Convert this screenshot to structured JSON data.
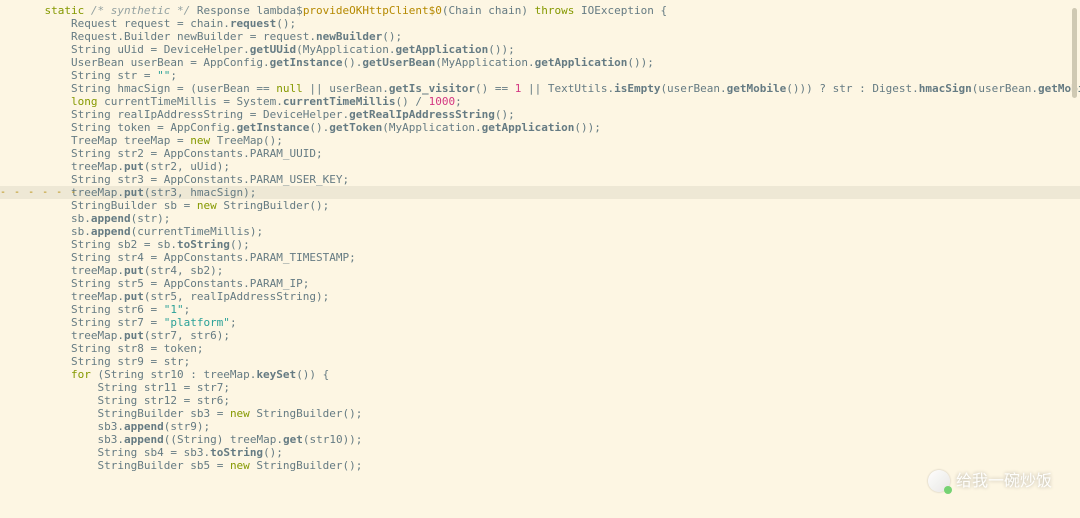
{
  "language": "java",
  "watermark": {
    "prefix": "",
    "text": "给我一碗炒饭",
    "icon_name": "wechat-icon"
  },
  "highlight_line_index": 14,
  "lines": [
    {
      "indent": 1,
      "tokens": [
        {
          "t": "kw",
          "v": "static"
        },
        {
          "t": "sp"
        },
        {
          "t": "cm",
          "v": "/* synthetic */"
        },
        {
          "t": "sp"
        },
        {
          "t": "id",
          "v": "Response lambda$"
        },
        {
          "t": "fnacc",
          "v": "provideOKHttpClient$0"
        },
        {
          "t": "id",
          "v": "(Chain chain) "
        },
        {
          "t": "kw",
          "v": "throws"
        },
        {
          "t": "sp"
        },
        {
          "t": "id",
          "v": "IOException {"
        }
      ]
    },
    {
      "indent": 2,
      "tokens": [
        {
          "t": "id",
          "v": "Request request = chain."
        },
        {
          "t": "bold",
          "v": "request"
        },
        {
          "t": "id",
          "v": "();"
        }
      ]
    },
    {
      "indent": 2,
      "tokens": [
        {
          "t": "id",
          "v": "Request.Builder newBuilder = request."
        },
        {
          "t": "bold",
          "v": "newBuilder"
        },
        {
          "t": "id",
          "v": "();"
        }
      ]
    },
    {
      "indent": 2,
      "tokens": [
        {
          "t": "id",
          "v": "String uUid = DeviceHelper."
        },
        {
          "t": "bold",
          "v": "getUUid"
        },
        {
          "t": "id",
          "v": "(MyApplication."
        },
        {
          "t": "bold",
          "v": "getApplication"
        },
        {
          "t": "id",
          "v": "());"
        }
      ]
    },
    {
      "indent": 2,
      "tokens": [
        {
          "t": "id",
          "v": "UserBean userBean = AppConfig."
        },
        {
          "t": "bold",
          "v": "getInstance"
        },
        {
          "t": "id",
          "v": "()."
        },
        {
          "t": "bold",
          "v": "getUserBean"
        },
        {
          "t": "id",
          "v": "(MyApplication."
        },
        {
          "t": "bold",
          "v": "getApplication"
        },
        {
          "t": "id",
          "v": "());"
        }
      ]
    },
    {
      "indent": 2,
      "tokens": [
        {
          "t": "id",
          "v": "String str = "
        },
        {
          "t": "str",
          "v": "\"\""
        },
        {
          "t": "id",
          "v": ";"
        }
      ]
    },
    {
      "indent": 2,
      "tokens": [
        {
          "t": "id",
          "v": "String hmacSign = (userBean == "
        },
        {
          "t": "kw",
          "v": "null"
        },
        {
          "t": "id",
          "v": " || userBean."
        },
        {
          "t": "bold",
          "v": "getIs_visitor"
        },
        {
          "t": "id",
          "v": "() == "
        },
        {
          "t": "num",
          "v": "1"
        },
        {
          "t": "id",
          "v": " || TextUtils."
        },
        {
          "t": "bold",
          "v": "isEmpty"
        },
        {
          "t": "id",
          "v": "(userBean."
        },
        {
          "t": "bold",
          "v": "getMobile"
        },
        {
          "t": "id",
          "v": "())) ? str : Digest."
        },
        {
          "t": "bold",
          "v": "hmacSign"
        },
        {
          "t": "id",
          "v": "(userBean."
        },
        {
          "t": "bold",
          "v": "getMobile"
        },
        {
          "t": "id",
          "v": "());"
        }
      ]
    },
    {
      "indent": 2,
      "tokens": [
        {
          "t": "kw",
          "v": "long"
        },
        {
          "t": "id",
          "v": " currentTimeMillis = System."
        },
        {
          "t": "bold",
          "v": "currentTimeMillis"
        },
        {
          "t": "id",
          "v": "() / "
        },
        {
          "t": "num",
          "v": "1000"
        },
        {
          "t": "id",
          "v": ";"
        }
      ]
    },
    {
      "indent": 2,
      "tokens": [
        {
          "t": "id",
          "v": "String realIpAddressString = DeviceHelper."
        },
        {
          "t": "bold",
          "v": "getRealIpAddressString"
        },
        {
          "t": "id",
          "v": "();"
        }
      ]
    },
    {
      "indent": 2,
      "tokens": [
        {
          "t": "id",
          "v": "String token = AppConfig."
        },
        {
          "t": "bold",
          "v": "getInstance"
        },
        {
          "t": "id",
          "v": "()."
        },
        {
          "t": "bold",
          "v": "getToken"
        },
        {
          "t": "id",
          "v": "(MyApplication."
        },
        {
          "t": "bold",
          "v": "getApplication"
        },
        {
          "t": "id",
          "v": "());"
        }
      ]
    },
    {
      "indent": 2,
      "tokens": [
        {
          "t": "id",
          "v": "TreeMap treeMap = "
        },
        {
          "t": "kw",
          "v": "new"
        },
        {
          "t": "id",
          "v": " TreeMap();"
        }
      ]
    },
    {
      "indent": 2,
      "tokens": [
        {
          "t": "id",
          "v": "String str2 = AppConstants.PARAM_UUID;"
        }
      ]
    },
    {
      "indent": 2,
      "tokens": [
        {
          "t": "id",
          "v": "treeMap."
        },
        {
          "t": "bold",
          "v": "put"
        },
        {
          "t": "id",
          "v": "(str2, uUid);"
        }
      ]
    },
    {
      "indent": 2,
      "tokens": [
        {
          "t": "id",
          "v": "String str3 = AppConstants.PARAM_USER_KEY;"
        }
      ]
    },
    {
      "indent": 2,
      "hl": true,
      "tokens": [
        {
          "t": "id",
          "v": "treeMap."
        },
        {
          "t": "bold",
          "v": "put"
        },
        {
          "t": "id",
          "v": "(str3, hmacSign);"
        }
      ]
    },
    {
      "indent": 2,
      "tokens": [
        {
          "t": "id",
          "v": "StringBuilder sb = "
        },
        {
          "t": "kw",
          "v": "new"
        },
        {
          "t": "id",
          "v": " StringBuilder();"
        }
      ]
    },
    {
      "indent": 2,
      "tokens": [
        {
          "t": "id",
          "v": "sb."
        },
        {
          "t": "bold",
          "v": "append"
        },
        {
          "t": "id",
          "v": "(str);"
        }
      ]
    },
    {
      "indent": 2,
      "tokens": [
        {
          "t": "id",
          "v": "sb."
        },
        {
          "t": "bold",
          "v": "append"
        },
        {
          "t": "id",
          "v": "(currentTimeMillis);"
        }
      ]
    },
    {
      "indent": 2,
      "tokens": [
        {
          "t": "id",
          "v": "String sb2 = sb."
        },
        {
          "t": "bold",
          "v": "toString"
        },
        {
          "t": "id",
          "v": "();"
        }
      ]
    },
    {
      "indent": 2,
      "tokens": [
        {
          "t": "id",
          "v": "String str4 = AppConstants.PARAM_TIMESTAMP;"
        }
      ]
    },
    {
      "indent": 2,
      "tokens": [
        {
          "t": "id",
          "v": "treeMap."
        },
        {
          "t": "bold",
          "v": "put"
        },
        {
          "t": "id",
          "v": "(str4, sb2);"
        }
      ]
    },
    {
      "indent": 2,
      "tokens": [
        {
          "t": "id",
          "v": "String str5 = AppConstants.PARAM_IP;"
        }
      ]
    },
    {
      "indent": 2,
      "tokens": [
        {
          "t": "id",
          "v": "treeMap."
        },
        {
          "t": "bold",
          "v": "put"
        },
        {
          "t": "id",
          "v": "(str5, realIpAddressString);"
        }
      ]
    },
    {
      "indent": 2,
      "tokens": [
        {
          "t": "id",
          "v": "String str6 = "
        },
        {
          "t": "str",
          "v": "\"1\""
        },
        {
          "t": "id",
          "v": ";"
        }
      ]
    },
    {
      "indent": 2,
      "tokens": [
        {
          "t": "id",
          "v": "String str7 = "
        },
        {
          "t": "str",
          "v": "\"platform\""
        },
        {
          "t": "id",
          "v": ";"
        }
      ]
    },
    {
      "indent": 2,
      "tokens": [
        {
          "t": "id",
          "v": "treeMap."
        },
        {
          "t": "bold",
          "v": "put"
        },
        {
          "t": "id",
          "v": "(str7, str6);"
        }
      ]
    },
    {
      "indent": 2,
      "tokens": [
        {
          "t": "id",
          "v": "String str8 = token;"
        }
      ]
    },
    {
      "indent": 2,
      "tokens": [
        {
          "t": "id",
          "v": "String str9 = str;"
        }
      ]
    },
    {
      "indent": 2,
      "tokens": [
        {
          "t": "kw",
          "v": "for"
        },
        {
          "t": "id",
          "v": " (String str10 : treeMap."
        },
        {
          "t": "bold",
          "v": "keySet"
        },
        {
          "t": "id",
          "v": "()) {"
        }
      ]
    },
    {
      "indent": 3,
      "tokens": [
        {
          "t": "id",
          "v": "String str11 = str7;"
        }
      ]
    },
    {
      "indent": 3,
      "tokens": [
        {
          "t": "id",
          "v": "String str12 = str6;"
        }
      ]
    },
    {
      "indent": 3,
      "tokens": [
        {
          "t": "id",
          "v": "StringBuilder sb3 = "
        },
        {
          "t": "kw",
          "v": "new"
        },
        {
          "t": "id",
          "v": " StringBuilder();"
        }
      ]
    },
    {
      "indent": 3,
      "tokens": [
        {
          "t": "id",
          "v": "sb3."
        },
        {
          "t": "bold",
          "v": "append"
        },
        {
          "t": "id",
          "v": "(str9);"
        }
      ]
    },
    {
      "indent": 3,
      "tokens": [
        {
          "t": "id",
          "v": "sb3."
        },
        {
          "t": "bold",
          "v": "append"
        },
        {
          "t": "id",
          "v": "((String) treeMap."
        },
        {
          "t": "bold",
          "v": "get"
        },
        {
          "t": "id",
          "v": "(str10));"
        }
      ]
    },
    {
      "indent": 3,
      "tokens": [
        {
          "t": "id",
          "v": "String sb4 = sb3."
        },
        {
          "t": "bold",
          "v": "toString"
        },
        {
          "t": "id",
          "v": "();"
        }
      ]
    },
    {
      "indent": 3,
      "tokens": [
        {
          "t": "id",
          "v": "StringBuilder sb5 = "
        },
        {
          "t": "kw",
          "v": "new"
        },
        {
          "t": "id",
          "v": " StringBuilder();"
        }
      ]
    }
  ]
}
